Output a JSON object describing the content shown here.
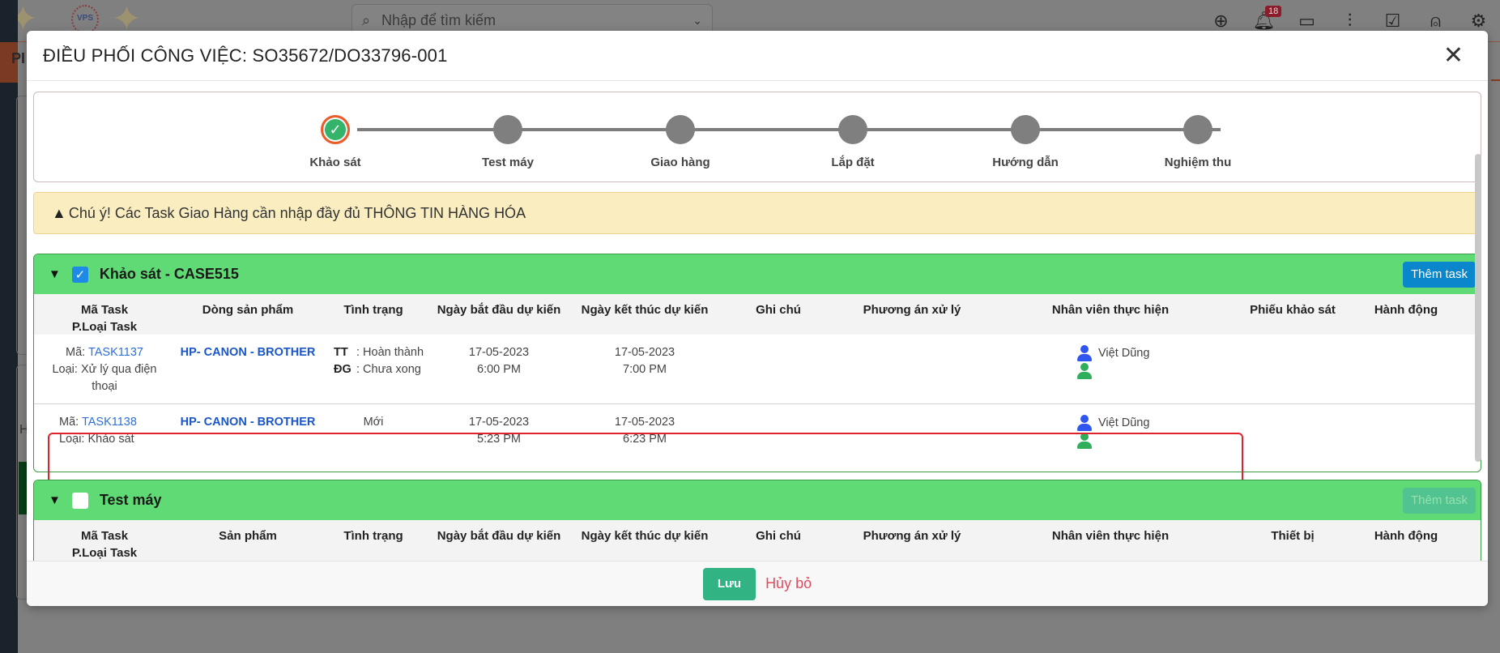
{
  "background": {
    "search_placeholder": "Nhập để tìm kiếm",
    "notification_count": "18",
    "page_title_partial": "PI",
    "left_letter": "H",
    "logo_text": "VPS"
  },
  "modal": {
    "title": "ĐIỀU PHỐI CÔNG VIỆC: SO35672/DO33796-001",
    "close_symbol": "✕"
  },
  "stepper": {
    "steps": [
      {
        "label": "Khảo sát",
        "status": "done"
      },
      {
        "label": "Test máy",
        "status": "pending"
      },
      {
        "label": "Giao hàng",
        "status": "pending"
      },
      {
        "label": "Lắp đặt",
        "status": "pending"
      },
      {
        "label": "Hướng dẫn",
        "status": "pending"
      },
      {
        "label": "Nghiệm thu",
        "status": "pending"
      }
    ],
    "check_symbol": "✓"
  },
  "alert": {
    "icon": "warning-icon",
    "text": "Chú ý! Các Task Giao Hàng cần nhập đầy đủ THÔNG TIN HÀNG HÓA"
  },
  "sections": [
    {
      "title": "Khảo sát - CASE515",
      "checked": true,
      "add_button": "Thêm task",
      "columns": [
        "Mã Task\nP.Loại Task",
        "Dòng sản phẩm",
        "Tình trạng",
        "Ngày bắt đầu dự kiến",
        "Ngày kết thúc dự kiến",
        "Ghi chú",
        "Phương án xử lý",
        "Nhân viên thực hiện",
        "Phiếu khảo sát",
        "Hành động"
      ],
      "col_header_1a": "Mã Task",
      "col_header_1b": "P.Loại Task",
      "rows": [
        {
          "code_prefix": "Mã: ",
          "code": "TASK1137",
          "type": "Loại: Xử lý qua điện thoại",
          "product": "HP- CANON - BROTHER",
          "status_tt_label": "TT",
          "status_tt": ": Hoàn thành",
          "status_dg_label": "ĐG",
          "status_dg": ": Chưa xong",
          "start_date": "17-05-2023",
          "start_time": "6:00 PM",
          "end_date": "17-05-2023",
          "end_time": "7:00 PM",
          "note": "",
          "solution": "",
          "employee": "Việt Dũng",
          "survey": "",
          "action": ""
        },
        {
          "code_prefix": "Mã: ",
          "code": "TASK1138",
          "type": "Loại: Khảo sát",
          "product": "HP- CANON - BROTHER",
          "status": "Mới",
          "start_date": "17-05-2023",
          "start_time": "5:23 PM",
          "end_date": "17-05-2023",
          "end_time": "6:23 PM",
          "note": "",
          "solution": "",
          "employee": "Việt Dũng",
          "survey": "",
          "action": ""
        }
      ]
    },
    {
      "title": "Test máy",
      "checked": false,
      "add_button": "Thêm task",
      "add_button_disabled": true,
      "col_header_1a": "Mã Task",
      "col_header_1b": "P.Loại Task",
      "columns": [
        "Mã Task\nP.Loại Task",
        "Sản phẩm",
        "Tình trạng",
        "Ngày bắt đầu dự kiến",
        "Ngày kết thúc dự kiến",
        "Ghi chú",
        "Phương án xử lý",
        "Nhân viên thực hiện",
        "Thiết bị",
        "Hành động"
      ]
    }
  ],
  "footer": {
    "save_label": "Lưu",
    "cancel_label": "Hủy bỏ"
  },
  "colors": {
    "section_header": "#60da74",
    "add_button": "#0a86cc",
    "save_button": "#31b383",
    "cancel_text": "#e04b5f",
    "step_done": "#34b36b",
    "step_pending": "#7f7f7f",
    "highlight_border": "#e0232a"
  }
}
